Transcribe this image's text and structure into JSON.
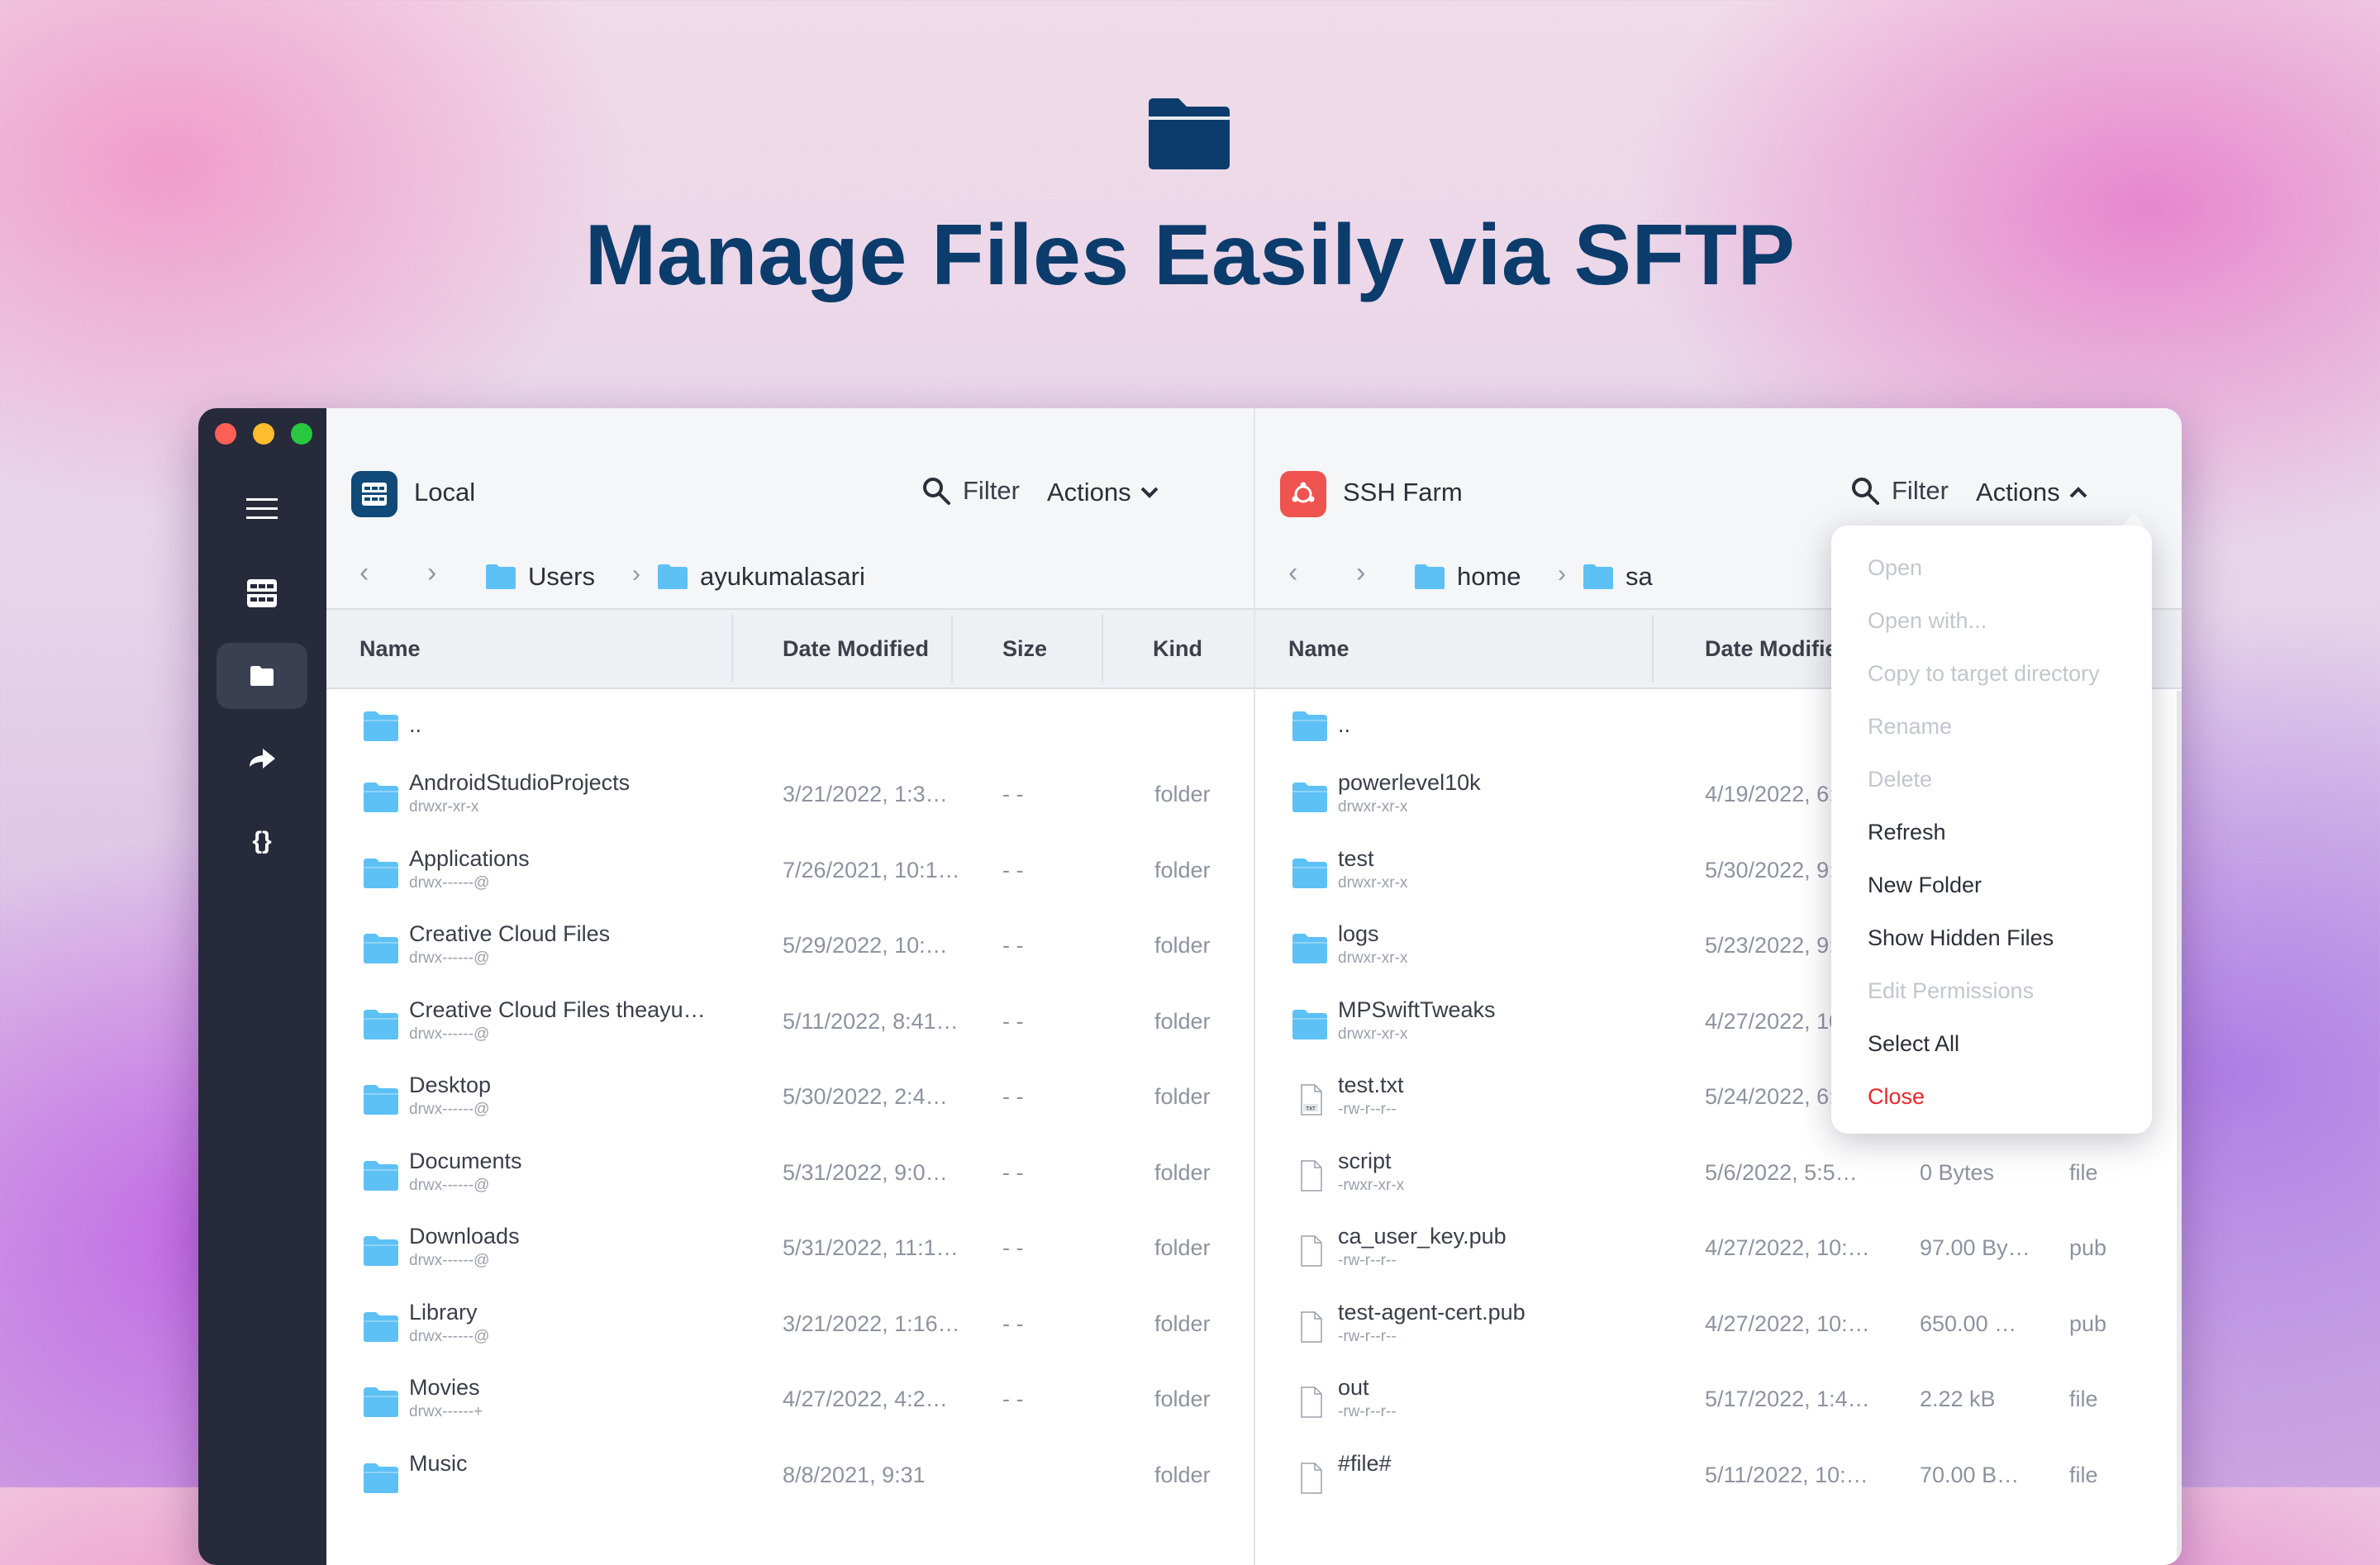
{
  "hero": {
    "title": "Manage Files Easily via SFTP",
    "icon": "folder-icon"
  },
  "sidebar": {
    "items": [
      "menu-icon",
      "hosts-icon",
      "sftp-icon",
      "port-forward-icon",
      "snippets-icon"
    ]
  },
  "left": {
    "host": "Local",
    "filter_label": "Filter",
    "actions_label": "Actions",
    "breadcrumb": [
      "Users",
      "ayukumalasari"
    ],
    "columns": [
      "Name",
      "Date Modified",
      "Size",
      "Kind"
    ],
    "parent": "..",
    "rows": [
      {
        "name": "AndroidStudioProjects",
        "perm": "drwxr-xr-x",
        "date": "3/21/2022, 1:3…",
        "size": "- -",
        "kind": "folder"
      },
      {
        "name": "Applications",
        "perm": "drwx------@",
        "date": "7/26/2021, 10:1…",
        "size": "- -",
        "kind": "folder"
      },
      {
        "name": "Creative Cloud Files",
        "perm": "drwx------@",
        "date": "5/29/2022, 10:…",
        "size": "- -",
        "kind": "folder"
      },
      {
        "name": "Creative Cloud Files theayu…",
        "perm": "drwx------@",
        "date": "5/11/2022, 8:41…",
        "size": "- -",
        "kind": "folder"
      },
      {
        "name": "Desktop",
        "perm": "drwx------@",
        "date": "5/30/2022, 2:4…",
        "size": "- -",
        "kind": "folder"
      },
      {
        "name": "Documents",
        "perm": "drwx------@",
        "date": "5/31/2022, 9:0…",
        "size": "- -",
        "kind": "folder"
      },
      {
        "name": "Downloads",
        "perm": "drwx------@",
        "date": "5/31/2022, 11:1…",
        "size": "- -",
        "kind": "folder"
      },
      {
        "name": "Library",
        "perm": "drwx------@",
        "date": "3/21/2022, 1:16…",
        "size": "- -",
        "kind": "folder"
      },
      {
        "name": "Movies",
        "perm": "drwx------+",
        "date": "4/27/2022, 4:2…",
        "size": "- -",
        "kind": "folder"
      },
      {
        "name": "Music",
        "perm": "",
        "date": "8/8/2021, 9:31",
        "size": "",
        "kind": "folder"
      }
    ]
  },
  "right": {
    "host": "SSH Farm",
    "filter_label": "Filter",
    "actions_label": "Actions",
    "breadcrumb": [
      "home",
      "sa"
    ],
    "columns": [
      "Name",
      "Date Modified"
    ],
    "parent": "..",
    "rows": [
      {
        "name": "powerlevel10k",
        "perm": "drwxr-xr-x",
        "date": "4/19/2022, 6:2…",
        "size": "",
        "kind": "",
        "type": "folder"
      },
      {
        "name": "test",
        "perm": "drwxr-xr-x",
        "date": "5/30/2022, 9:…",
        "size": "",
        "kind": "",
        "type": "folder"
      },
      {
        "name": "logs",
        "perm": "drwxr-xr-x",
        "date": "5/23/2022, 9:…",
        "size": "",
        "kind": "",
        "type": "folder"
      },
      {
        "name": "MPSwiftTweaks",
        "perm": "drwxr-xr-x",
        "date": "4/27/2022, 10:…",
        "size": "",
        "kind": "",
        "type": "folder"
      },
      {
        "name": "test.txt",
        "perm": "-rw-r--r--",
        "date": "5/24/2022, 6:…",
        "size": "",
        "kind": "",
        "type": "txt"
      },
      {
        "name": "script",
        "perm": "-rwxr-xr-x",
        "date": "5/6/2022, 5:5…",
        "size": "0 Bytes",
        "kind": "file",
        "type": "file"
      },
      {
        "name": "ca_user_key.pub",
        "perm": "-rw-r--r--",
        "date": "4/27/2022, 10:…",
        "size": "97.00 By…",
        "kind": "pub",
        "type": "file"
      },
      {
        "name": "test-agent-cert.pub",
        "perm": "-rw-r--r--",
        "date": "4/27/2022, 10:…",
        "size": "650.00 …",
        "kind": "pub",
        "type": "file"
      },
      {
        "name": "out",
        "perm": "-rw-r--r--",
        "date": "5/17/2022, 1:4…",
        "size": "2.22 kB",
        "kind": "file",
        "type": "file"
      },
      {
        "name": "#file#",
        "perm": "",
        "date": "5/11/2022, 10:…",
        "size": "70.00 B…",
        "kind": "file",
        "type": "file"
      }
    ]
  },
  "menu": [
    {
      "label": "Open",
      "state": "disabled"
    },
    {
      "label": "Open with...",
      "state": "disabled"
    },
    {
      "label": "Copy to target directory",
      "state": "disabled"
    },
    {
      "label": "Rename",
      "state": "disabled"
    },
    {
      "label": "Delete",
      "state": "disabled"
    },
    {
      "label": "Refresh",
      "state": "enabled"
    },
    {
      "label": "New Folder",
      "state": "enabled"
    },
    {
      "label": "Show Hidden Files",
      "state": "enabled"
    },
    {
      "label": "Edit Permissions",
      "state": "disabled"
    },
    {
      "label": "Select All",
      "state": "enabled"
    },
    {
      "label": "Close",
      "state": "danger"
    }
  ],
  "colors": {
    "folder": "#5ec1f5",
    "title": "#0b3c6b",
    "local_badge": "#0f4a78",
    "ssh_badge": "#ef5350",
    "sidebar": "#262a3b",
    "danger": "#e8262b"
  }
}
